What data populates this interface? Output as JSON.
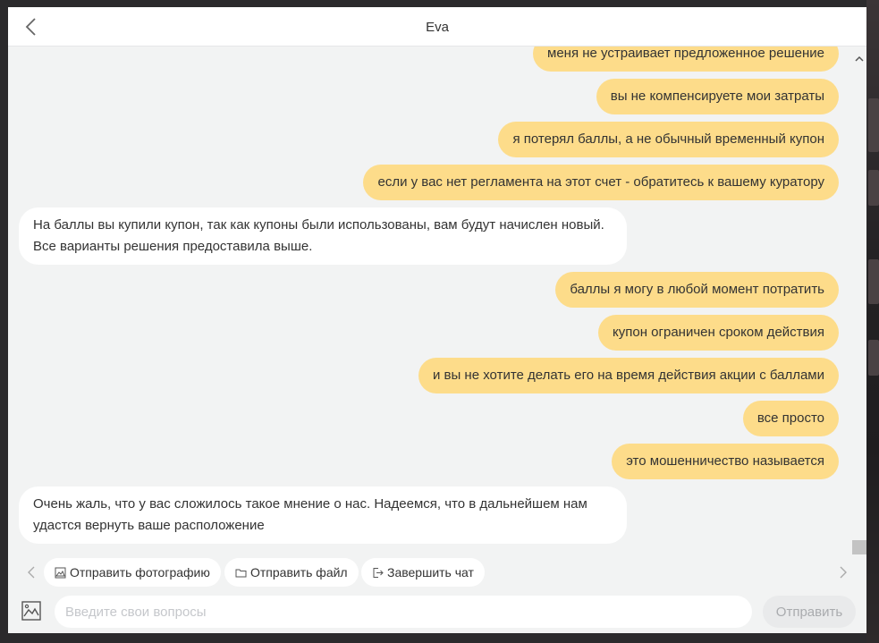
{
  "header": {
    "title": "Eva"
  },
  "messages": [
    {
      "dir": "out",
      "text": "меня не устраивает предложенное решение"
    },
    {
      "dir": "out",
      "text": "вы не компенсируете мои затраты"
    },
    {
      "dir": "out",
      "text": "я потерял баллы, а не обычный временный купон"
    },
    {
      "dir": "out",
      "text": "если у вас нет регламента на этот счет - обратитесь к вашему куратору"
    },
    {
      "dir": "in",
      "text": "На баллы вы купили купон, так как купоны были использованы, вам будут начислен новый. Все варианты решения предоставила выше."
    },
    {
      "dir": "out",
      "text": "баллы я могу в любой момент потратить"
    },
    {
      "dir": "out",
      "text": "купон ограничен сроком действия"
    },
    {
      "dir": "out",
      "text": "и вы не хотите делать его на время действия акции с баллами"
    },
    {
      "dir": "out",
      "text": "все просто"
    },
    {
      "dir": "out",
      "text": "это мошенничество называется"
    },
    {
      "dir": "in",
      "text": "Очень жаль, что у вас сложилось такое мнение о нас. Надеемся, что в дальнейшем нам удастся вернуть ваше расположение"
    }
  ],
  "quick_actions": {
    "send_photo": "Отправить фотографию",
    "send_file": "Отправить файл",
    "end_chat": "Завершить чат"
  },
  "composer": {
    "placeholder": "Введите свои вопросы",
    "send_label": "Отправить"
  },
  "colors": {
    "outgoing_bubble": "#fddc8a",
    "incoming_bubble": "#ffffff",
    "background": "#f2f3f3"
  }
}
